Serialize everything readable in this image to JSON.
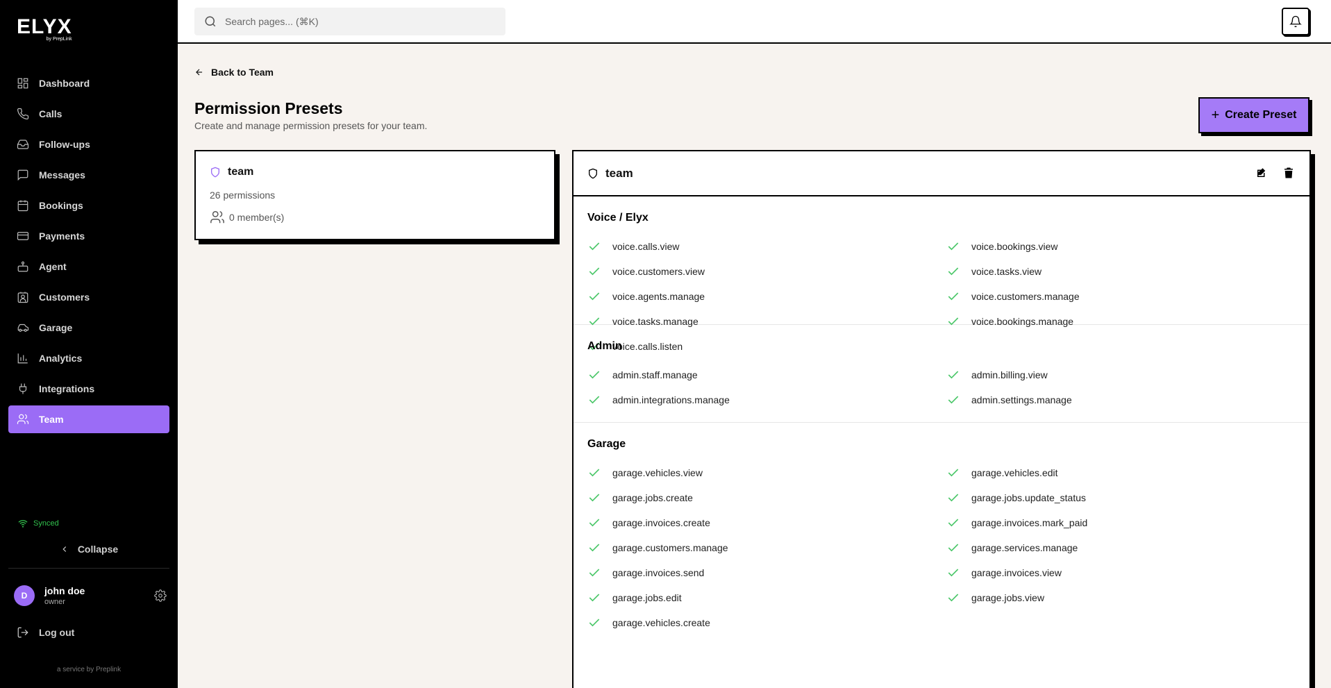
{
  "brand": {
    "name": "ELYX",
    "sub": "by PrepLink"
  },
  "sidebar": {
    "items": [
      {
        "label": "Dashboard",
        "icon": "dashboard-icon",
        "active": false
      },
      {
        "label": "Calls",
        "icon": "phone-icon",
        "active": false
      },
      {
        "label": "Follow-ups",
        "icon": "inbox-icon",
        "active": false
      },
      {
        "label": "Messages",
        "icon": "message-icon",
        "active": false
      },
      {
        "label": "Bookings",
        "icon": "calendar-icon",
        "active": false
      },
      {
        "label": "Payments",
        "icon": "credit-card-icon",
        "active": false
      },
      {
        "label": "Agent",
        "icon": "bot-icon",
        "active": false
      },
      {
        "label": "Customers",
        "icon": "contact-icon",
        "active": false
      },
      {
        "label": "Garage",
        "icon": "car-icon",
        "active": false
      },
      {
        "label": "Analytics",
        "icon": "bar-chart-icon",
        "active": false
      },
      {
        "label": "Integrations",
        "icon": "plug-icon",
        "active": false
      },
      {
        "label": "Team",
        "icon": "users-icon",
        "active": true
      }
    ],
    "synced": "Synced",
    "collapse": "Collapse",
    "user": {
      "initial": "D",
      "name": "john doe",
      "role": "owner"
    },
    "logout": "Log out",
    "service": "a service by Preplink"
  },
  "topbar": {
    "search_placeholder": "Search pages... (⌘K)"
  },
  "main": {
    "back": "Back to Team",
    "title": "Permission Presets",
    "subtitle": "Create and manage permission presets for your team.",
    "create_button": "Create Preset",
    "preset": {
      "name": "team",
      "permissions": "26 permissions",
      "members": "0 member(s)"
    },
    "detail": {
      "name": "team",
      "sections": [
        {
          "title": "Voice / Elyx",
          "left": [
            "voice.calls.view",
            "voice.customers.view",
            "voice.agents.manage",
            "voice.tasks.manage",
            "voice.calls.listen"
          ],
          "right": [
            "voice.bookings.view",
            "voice.tasks.view",
            "voice.customers.manage",
            "voice.bookings.manage"
          ]
        },
        {
          "title": "Admin",
          "left": [
            "admin.staff.manage",
            "admin.integrations.manage"
          ],
          "right": [
            "admin.billing.view",
            "admin.settings.manage"
          ]
        },
        {
          "title": "Garage",
          "left": [
            "garage.vehicles.view",
            "garage.jobs.create",
            "garage.invoices.create",
            "garage.customers.manage",
            "garage.invoices.send",
            "garage.jobs.edit",
            "garage.vehicles.create"
          ],
          "right": [
            "garage.vehicles.edit",
            "garage.jobs.update_status",
            "garage.invoices.mark_paid",
            "garage.services.manage",
            "garage.invoices.view",
            "garage.jobs.view"
          ]
        }
      ]
    }
  },
  "colors": {
    "accent": "#9b6cf6",
    "check": "#4cc76a",
    "background": "#f7f3ef"
  }
}
